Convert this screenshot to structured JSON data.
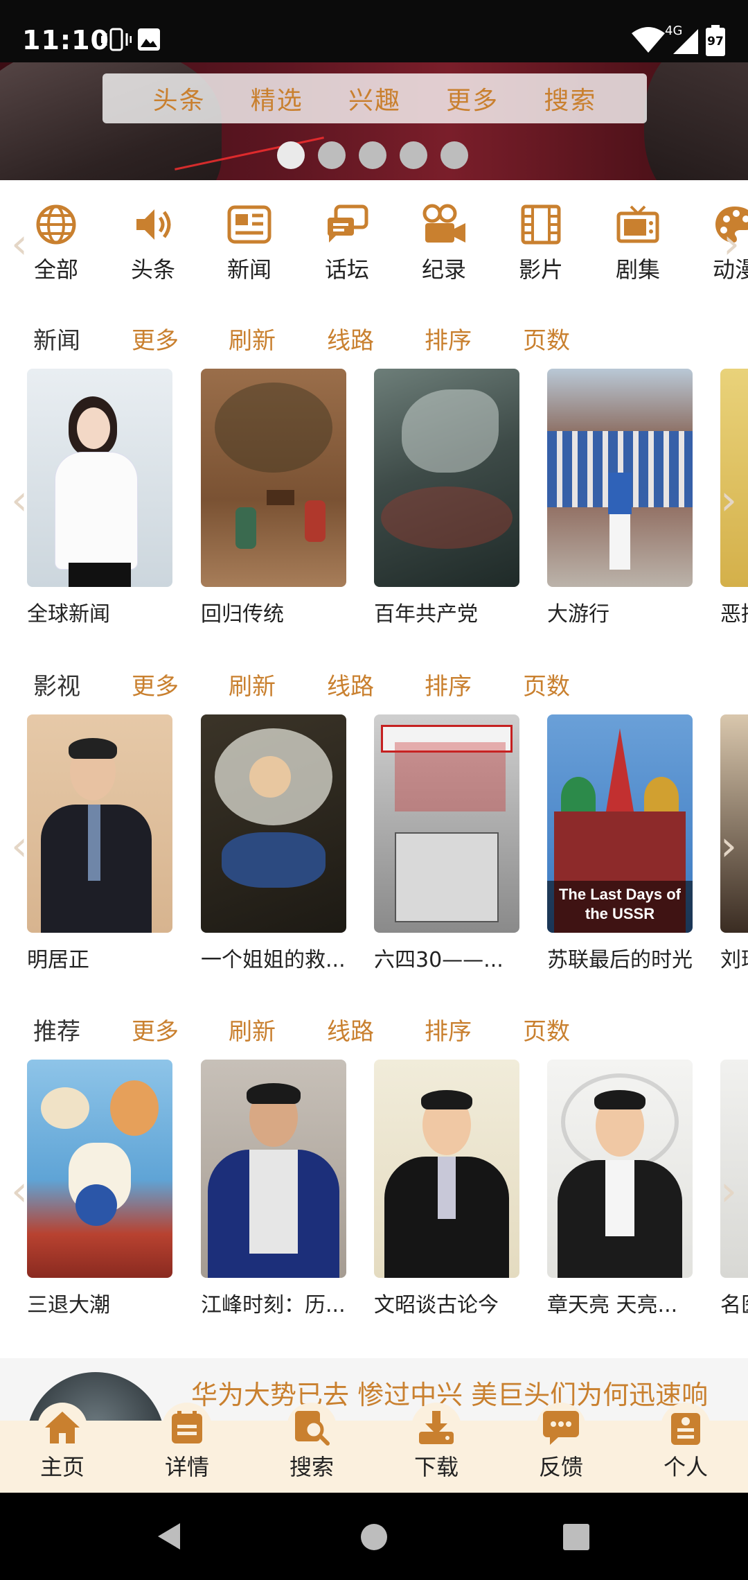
{
  "status_bar": {
    "time": "11:10",
    "network": "4G",
    "battery": "97"
  },
  "top_nav": {
    "items": [
      "头条",
      "精选",
      "兴趣",
      "更多",
      "搜索"
    ]
  },
  "carousel": {
    "page_count": 5,
    "active_index": 0
  },
  "categories": {
    "items": [
      {
        "label": "全部",
        "icon": "globe-icon"
      },
      {
        "label": "头条",
        "icon": "speaker-icon"
      },
      {
        "label": "新闻",
        "icon": "newspaper-icon"
      },
      {
        "label": "话坛",
        "icon": "chat-icon"
      },
      {
        "label": "纪录",
        "icon": "camera-icon"
      },
      {
        "label": "影片",
        "icon": "film-icon"
      },
      {
        "label": "剧集",
        "icon": "tv-icon"
      },
      {
        "label": "动漫",
        "icon": "palette-icon"
      }
    ]
  },
  "sections": [
    {
      "title": "新闻",
      "actions": [
        "更多",
        "刷新",
        "线路",
        "排序",
        "页数"
      ],
      "items": [
        {
          "title": "全球新闻"
        },
        {
          "title": "回归传统"
        },
        {
          "title": "百年共产党"
        },
        {
          "title": "大游行"
        },
        {
          "title": "恶搞"
        }
      ]
    },
    {
      "title": "影视",
      "actions": [
        "更多",
        "刷新",
        "线路",
        "排序",
        "页数"
      ],
      "items": [
        {
          "title": "明居正"
        },
        {
          "title": "一个姐姐的救..."
        },
        {
          "title": "六四30——..."
        },
        {
          "title": "苏联最后的时光",
          "overlay": "The Last Days of the USSR"
        },
        {
          "title": "刘瑞"
        }
      ]
    },
    {
      "title": "推荐",
      "actions": [
        "更多",
        "刷新",
        "线路",
        "排序",
        "页数"
      ],
      "items": [
        {
          "title": "三退大潮"
        },
        {
          "title": "江峰时刻：历..."
        },
        {
          "title": "文昭谈古论今"
        },
        {
          "title": "章天亮 天亮..."
        },
        {
          "title": "名医"
        }
      ]
    }
  ],
  "ticker": {
    "text": "华为大势已去 惨过中兴 美巨头们为何迅速响"
  },
  "bottom_nav": {
    "items": [
      {
        "label": "主页",
        "icon": "home-icon"
      },
      {
        "label": "详情",
        "icon": "details-icon"
      },
      {
        "label": "搜索",
        "icon": "search-icon"
      },
      {
        "label": "下载",
        "icon": "download-icon"
      },
      {
        "label": "反馈",
        "icon": "feedback-icon"
      },
      {
        "label": "个人",
        "icon": "profile-icon"
      }
    ]
  },
  "colors": {
    "accent": "#c9802f",
    "nav_bg": "#fbf0de"
  }
}
